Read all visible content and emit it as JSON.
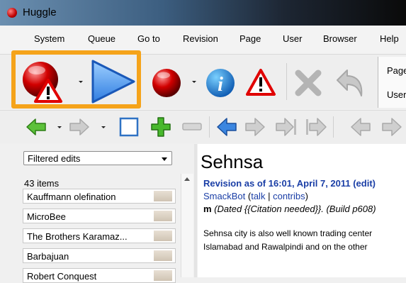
{
  "window": {
    "title": "Huggle"
  },
  "menu": [
    "System",
    "Queue",
    "Go to",
    "Revision",
    "Page",
    "User",
    "Browser",
    "Help"
  ],
  "right_tabs": [
    "Page",
    "User"
  ],
  "filter": {
    "selected": "Filtered edits"
  },
  "queue": {
    "count": "43 items",
    "items": [
      "Kauffmann olefination",
      "MicroBee",
      "The Brothers Karamaz...",
      "Barbajuan",
      "Robert Conquest"
    ]
  },
  "article": {
    "title": "Sehnsa",
    "revision_header": "Revision as of 16:01, April 7, 2011 (edit)",
    "user": "SmackBot",
    "open_paren": "(",
    "talk": "talk",
    "sep": "|",
    "contribs": "contribs",
    "close_paren": ")",
    "minor_flag": "m",
    "summary": "(Dated {{Citation needed}}. (Build p608)",
    "body_line1": "Sehnsa city is also well known trading center",
    "body_line2": "Islamabad and Rawalpindi and on the other"
  },
  "colors": {
    "highlight_border": "#f5a31a",
    "link_blue": "#1a3ea6",
    "warn_red": "#c00000",
    "play_blue": "#2f7de1"
  },
  "icons": [
    "revert-warn-icon",
    "next-edit-play-icon",
    "revert-icon",
    "info-icon",
    "warning-icon",
    "cancel-icon",
    "undo-icon",
    "back-icon",
    "forward-icon",
    "blank-page-icon",
    "add-icon",
    "remove-icon",
    "diff-previous-icon",
    "diff-next-icon",
    "diff-latest-icon",
    "diff-last-icon"
  ]
}
